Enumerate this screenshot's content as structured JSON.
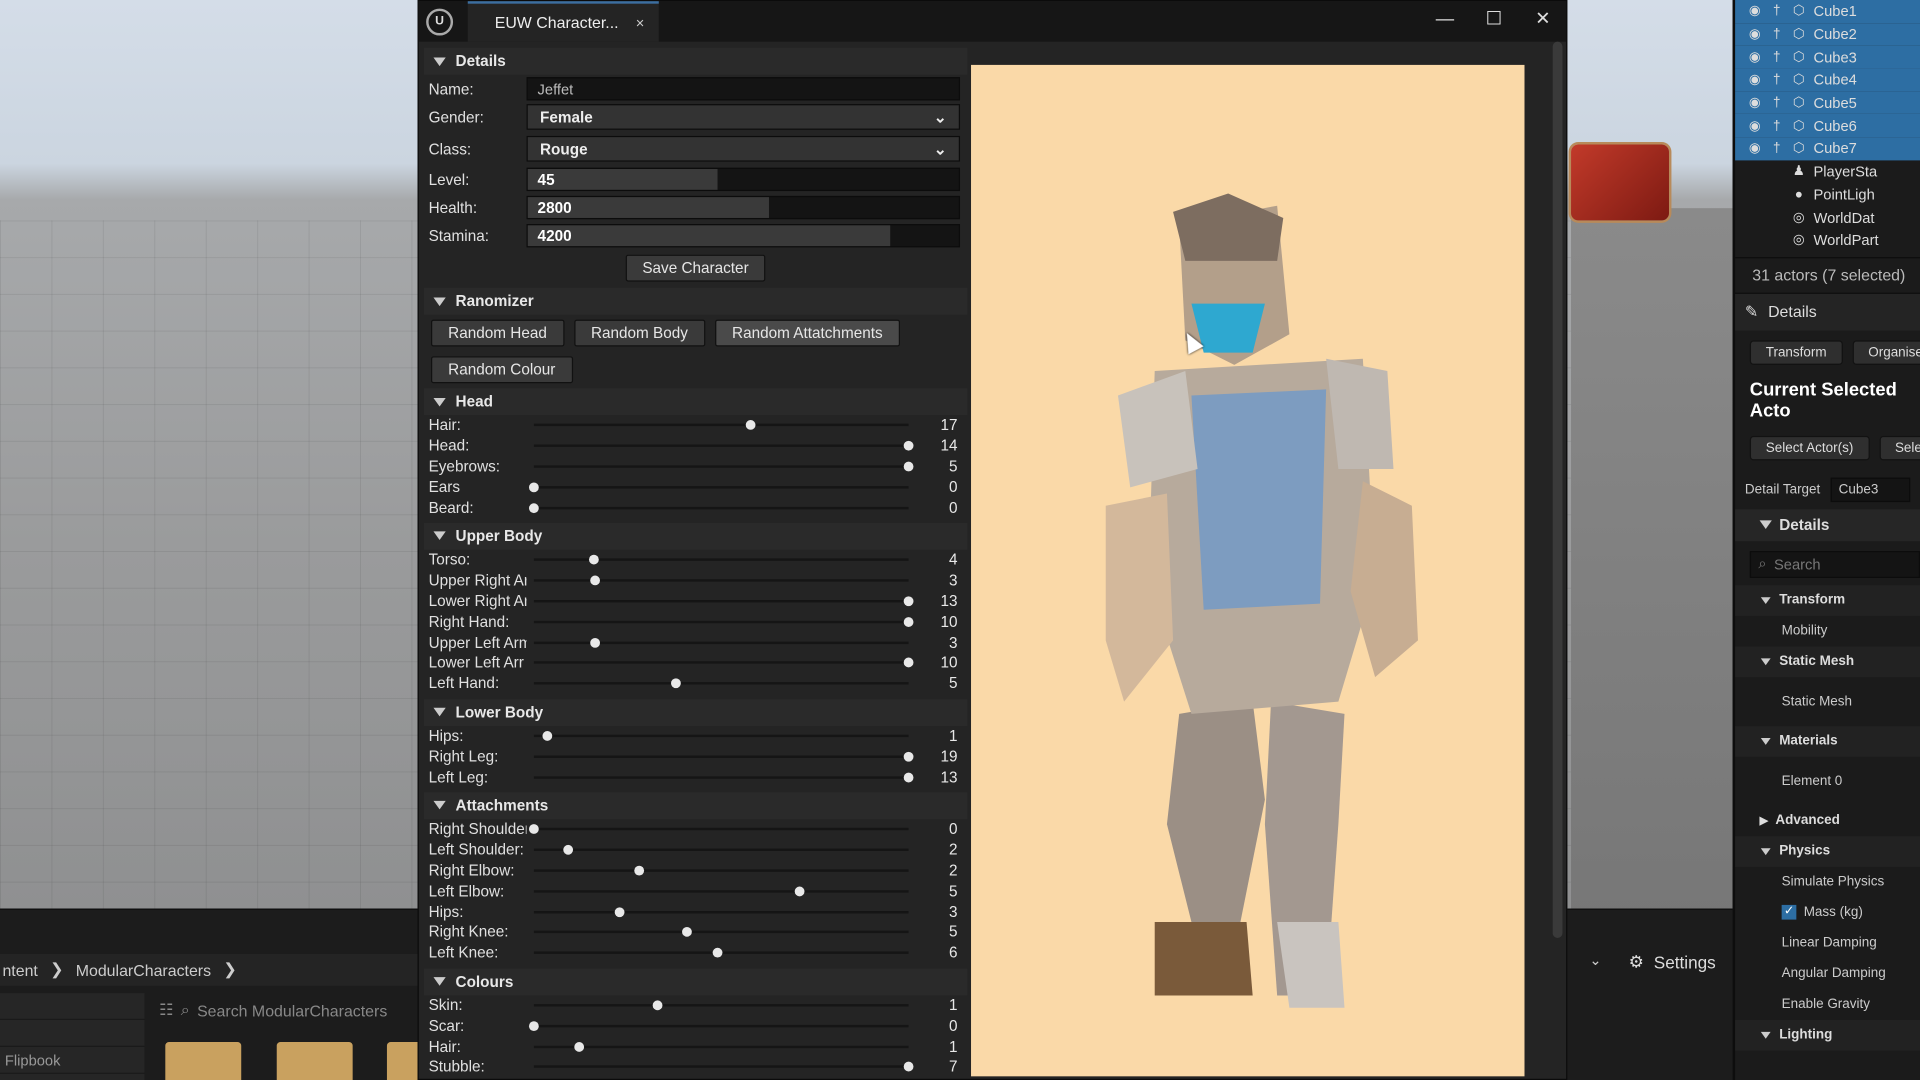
{
  "window": {
    "tab_title": "EUW Character...",
    "close_glyph": "×",
    "minimize_glyph": "—",
    "maximize_glyph": "☐",
    "window_close_glyph": "✕"
  },
  "details": {
    "header": "Details",
    "name_label": "Name:",
    "name_value": "Jeffet",
    "gender_label": "Gender:",
    "gender_value": "Female",
    "class_label": "Class:",
    "class_value": "Rouge",
    "level_label": "Level:",
    "level_value": "45",
    "level_fraction": 0.44,
    "health_label": "Health:",
    "health_value": "2800",
    "health_fraction": 0.56,
    "stamina_label": "Stamina:",
    "stamina_value": "4200",
    "stamina_fraction": 0.84,
    "save_label": "Save Character"
  },
  "randomizer": {
    "header": "Ranomizer",
    "buttons": [
      "Random Head",
      "Random Body",
      "Random Attatchments",
      "Random Colour"
    ]
  },
  "slider_sections": [
    {
      "header": "Head",
      "rows": [
        {
          "label": "Hair:",
          "value": "17",
          "fraction": 0.58
        },
        {
          "label": "Head:",
          "value": "14",
          "fraction": 1.0
        },
        {
          "label": "Eyebrows:",
          "value": "5",
          "fraction": 1.0
        },
        {
          "label": "Ears",
          "value": "0",
          "fraction": 0.0
        },
        {
          "label": "Beard:",
          "value": "0",
          "fraction": 0.0
        }
      ]
    },
    {
      "header": "Upper Body",
      "rows": [
        {
          "label": "Torso:",
          "value": "4",
          "fraction": 0.16
        },
        {
          "label": "Upper Right Ar",
          "value": "3",
          "fraction": 0.165
        },
        {
          "label": "Lower Right Ar",
          "value": "13",
          "fraction": 1.0
        },
        {
          "label": "Right Hand:",
          "value": "10",
          "fraction": 1.0
        },
        {
          "label": "Upper Left Arm",
          "value": "3",
          "fraction": 0.165
        },
        {
          "label": "Lower Left Arr",
          "value": "10",
          "fraction": 1.0
        },
        {
          "label": "Left Hand:",
          "value": "5",
          "fraction": 0.38
        }
      ]
    },
    {
      "header": "Lower Body",
      "rows": [
        {
          "label": "Hips:",
          "value": "1",
          "fraction": 0.035
        },
        {
          "label": "Right Leg:",
          "value": "19",
          "fraction": 1.0
        },
        {
          "label": "Left Leg:",
          "value": "13",
          "fraction": 1.0
        }
      ]
    },
    {
      "header": "Attachments",
      "rows": [
        {
          "label": "Right Shoulder",
          "value": "0",
          "fraction": 0.0
        },
        {
          "label": "Left Shoulder:",
          "value": "2",
          "fraction": 0.09
        },
        {
          "label": "Right Elbow:",
          "value": "2",
          "fraction": 0.28
        },
        {
          "label": "Left Elbow:",
          "value": "5",
          "fraction": 0.71
        },
        {
          "label": "Hips:",
          "value": "3",
          "fraction": 0.23
        },
        {
          "label": "Right Knee:",
          "value": "5",
          "fraction": 0.41
        },
        {
          "label": "Left Knee:",
          "value": "6",
          "fraction": 0.49
        }
      ]
    },
    {
      "header": "Colours",
      "rows": [
        {
          "label": "Skin:",
          "value": "1",
          "fraction": 0.33
        },
        {
          "label": "Scar:",
          "value": "0",
          "fraction": 0.0
        },
        {
          "label": "Hair:",
          "value": "1",
          "fraction": 0.12
        },
        {
          "label": "Stubble:",
          "value": "7",
          "fraction": 1.0
        }
      ]
    }
  ],
  "content_browser": {
    "crumb_root": "ntent",
    "crumb_folder": "ModularCharacters",
    "search_placeholder": "Search ModularCharacters",
    "left_item": "Flipbook",
    "settings_label": "Settings"
  },
  "outliner": {
    "rows": [
      {
        "label": "Cube1",
        "selected": true,
        "icon": "mesh-icon"
      },
      {
        "label": "Cube2",
        "selected": true,
        "icon": "mesh-icon"
      },
      {
        "label": "Cube3",
        "selected": true,
        "icon": "mesh-icon"
      },
      {
        "label": "Cube4",
        "selected": true,
        "icon": "mesh-icon"
      },
      {
        "label": "Cube5",
        "selected": true,
        "icon": "mesh-icon"
      },
      {
        "label": "Cube6",
        "selected": true,
        "icon": "mesh-icon"
      },
      {
        "label": "Cube7",
        "selected": true,
        "icon": "mesh-icon"
      },
      {
        "label": "PlayerSta",
        "selected": false,
        "icon": "player-start-icon"
      },
      {
        "label": "PointLigh",
        "selected": false,
        "icon": "light-icon"
      },
      {
        "label": "WorldDat",
        "selected": false,
        "icon": "world-icon"
      },
      {
        "label": "WorldPart",
        "selected": false,
        "icon": "world-icon"
      }
    ],
    "count": "31 actors (7 selected)",
    "details_tab": "Details",
    "tab_transform": "Transform",
    "tab_organise": "Organise",
    "current_title": "Current Selected Acto",
    "select_actors": "Select Actor(s)",
    "select_other": "Selec",
    "detail_target_label": "Detail Target",
    "detail_target_value": "Cube3",
    "details_sub": "Details",
    "search_placeholder": "Search",
    "sections": [
      {
        "type": "sec",
        "label": "Transform"
      },
      {
        "type": "item",
        "label": "Mobility"
      },
      {
        "type": "sec",
        "label": "Static Mesh"
      },
      {
        "type": "item",
        "label": "Static Mesh"
      },
      {
        "type": "sec",
        "label": "Materials"
      },
      {
        "type": "item",
        "label": "Element 0"
      },
      {
        "type": "sec-closed",
        "label": "Advanced"
      },
      {
        "type": "sec",
        "label": "Physics"
      },
      {
        "type": "item",
        "label": "Simulate Physics"
      },
      {
        "type": "check",
        "label": "Mass (kg)"
      },
      {
        "type": "item",
        "label": "Linear Damping"
      },
      {
        "type": "item",
        "label": "Angular Damping"
      },
      {
        "type": "item",
        "label": "Enable Gravity"
      },
      {
        "type": "sec",
        "label": "Lighting"
      }
    ]
  },
  "colors": {
    "preview_bg": "#fad9a8",
    "selection": "#2d6ea3"
  }
}
